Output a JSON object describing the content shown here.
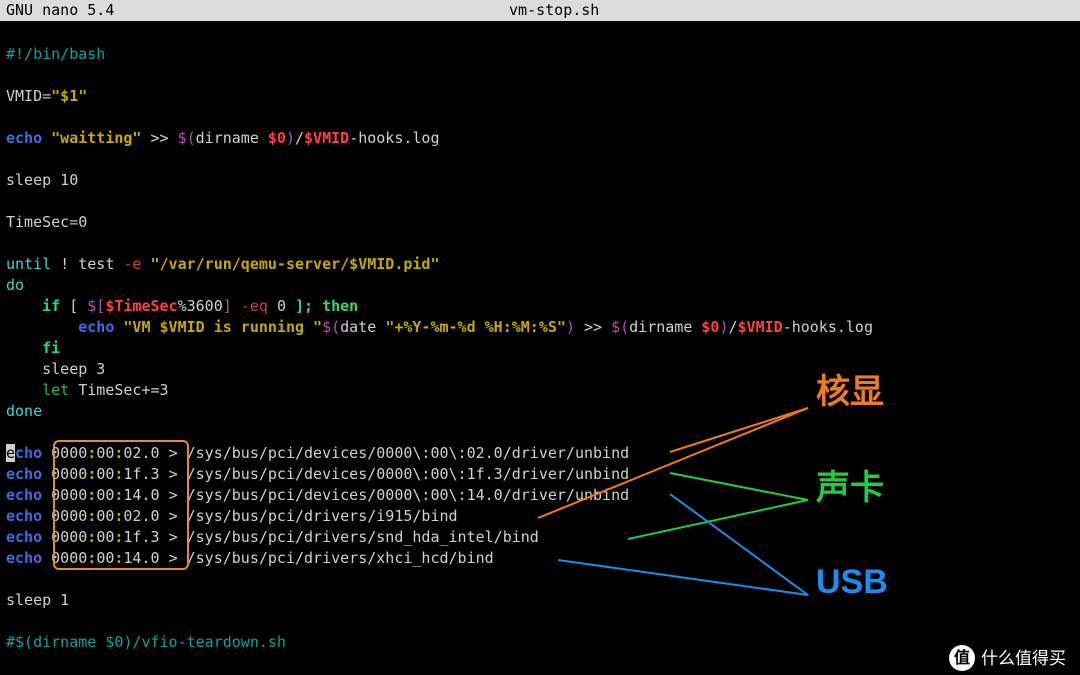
{
  "titlebar": {
    "app": "  GNU nano 5.4",
    "filename": "vm-stop.sh"
  },
  "code": {
    "shebang": "#!/bin/bash",
    "l_vmid_lhs": "VMID",
    "l_vmid_eq": "=",
    "l_vmid_rhs": "\"$1\"",
    "l_echo": "echo",
    "l_wait_str": "\"waitting\"",
    "l_redir": " >> ",
    "l_dol_open": "$(",
    "l_dirname": "dirname ",
    "l_arg0": "$0",
    "l_close": ")",
    "l_slash": "/",
    "l_vmid": "$VMID",
    "l_hooks": "-hooks.log",
    "l_sleep10": "sleep 10",
    "l_timesec0_l": "TimeSec",
    "l_timesec0_e": "=",
    "l_timesec0_r": "0",
    "l_until": "until",
    "l_bang": " ! ",
    "l_test": "test",
    "l_e": " -e ",
    "l_pidpath": "\"/var/run/qemu-server/$VMID.pid\"",
    "l_do": "do",
    "l_if": "    if",
    "l_if_open": " [ ",
    "l_if_dol": "$[",
    "l_timesec": "$TimeSec",
    "l_mod": "%3600",
    "l_close_sq": "]",
    "l_eq": " -eq ",
    "l_zero": "0",
    "l_if_tail": " ]; then",
    "l_echo2_pad": "        ",
    "l_runmsg": "\"VM $VMID is running \"",
    "l_date": "date ",
    "l_datefmt": "\"+%Y-%m-%d %H:%M:%S\"",
    "l_fi": "    fi",
    "l_sleep3": "    sleep 3",
    "l_let": "    let",
    "l_let_body": " TimeSec+=3",
    "l_done": "done",
    "e_inv": "e",
    "e_cho": "cho",
    "pci1_a": " 0000",
    "pci1_b": ":",
    "pci1_c": "00",
    "pci1_d": ":",
    "pci1_e": "02.0 ",
    "pci1_gt": ">",
    "pci1_path": " /sys/bus/pci/devices/0000\\:00\\:02.0/driver/unbind",
    "pci2_e": "1f.3 ",
    "pci2_path": " /sys/bus/pci/devices/0000\\:00\\:1f.3/driver/unbind",
    "pci3_e": "14.0 ",
    "pci3_path": " /sys/bus/pci/devices/0000\\:00\\:14.0/driver/unbind",
    "pci4_path": " /sys/bus/pci/drivers/i915/bind",
    "pci5_path": " /sys/bus/pci/drivers/snd_hda_intel/bind",
    "pci6_path": " /sys/bus/pci/drivers/xhci_hcd/bind",
    "l_sleep1": "sleep 1",
    "l_lastcomment": "#$(dirname $0)/vfio-teardown.sh"
  },
  "annotations": {
    "gpu": "核显",
    "audio": "声卡",
    "usb": "USB"
  },
  "watermark": {
    "char": "值",
    "text": "什么值得买"
  }
}
